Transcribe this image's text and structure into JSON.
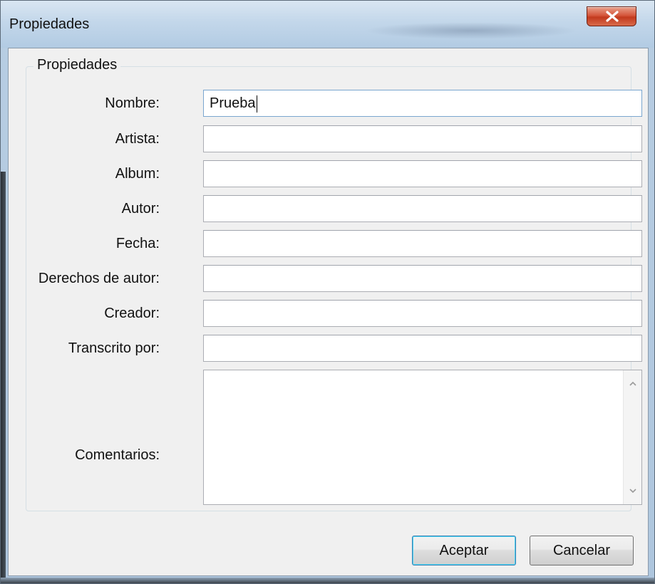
{
  "window": {
    "title": "Propiedades"
  },
  "group": {
    "legend": "Propiedades"
  },
  "fields": {
    "nombre": {
      "label": "Nombre:",
      "value": "Prueba"
    },
    "artista": {
      "label": "Artista:",
      "value": ""
    },
    "album": {
      "label": "Album:",
      "value": ""
    },
    "autor": {
      "label": "Autor:",
      "value": ""
    },
    "fecha": {
      "label": "Fecha:",
      "value": ""
    },
    "derechos": {
      "label": "Derechos de autor:",
      "value": ""
    },
    "creador": {
      "label": "Creador:",
      "value": ""
    },
    "transcrito": {
      "label": "Transcrito por:",
      "value": ""
    },
    "comentarios": {
      "label": "Comentarios:",
      "value": ""
    }
  },
  "buttons": {
    "accept": "Aceptar",
    "cancel": "Cancelar"
  },
  "icons": {
    "close": "close-icon",
    "scroll_up": "scroll-up-icon",
    "scroll_down": "scroll-down-icon"
  },
  "colors": {
    "close_button": "#c23a1e",
    "default_button_border": "#3c7fb1",
    "client_background": "#f0f0f0"
  }
}
